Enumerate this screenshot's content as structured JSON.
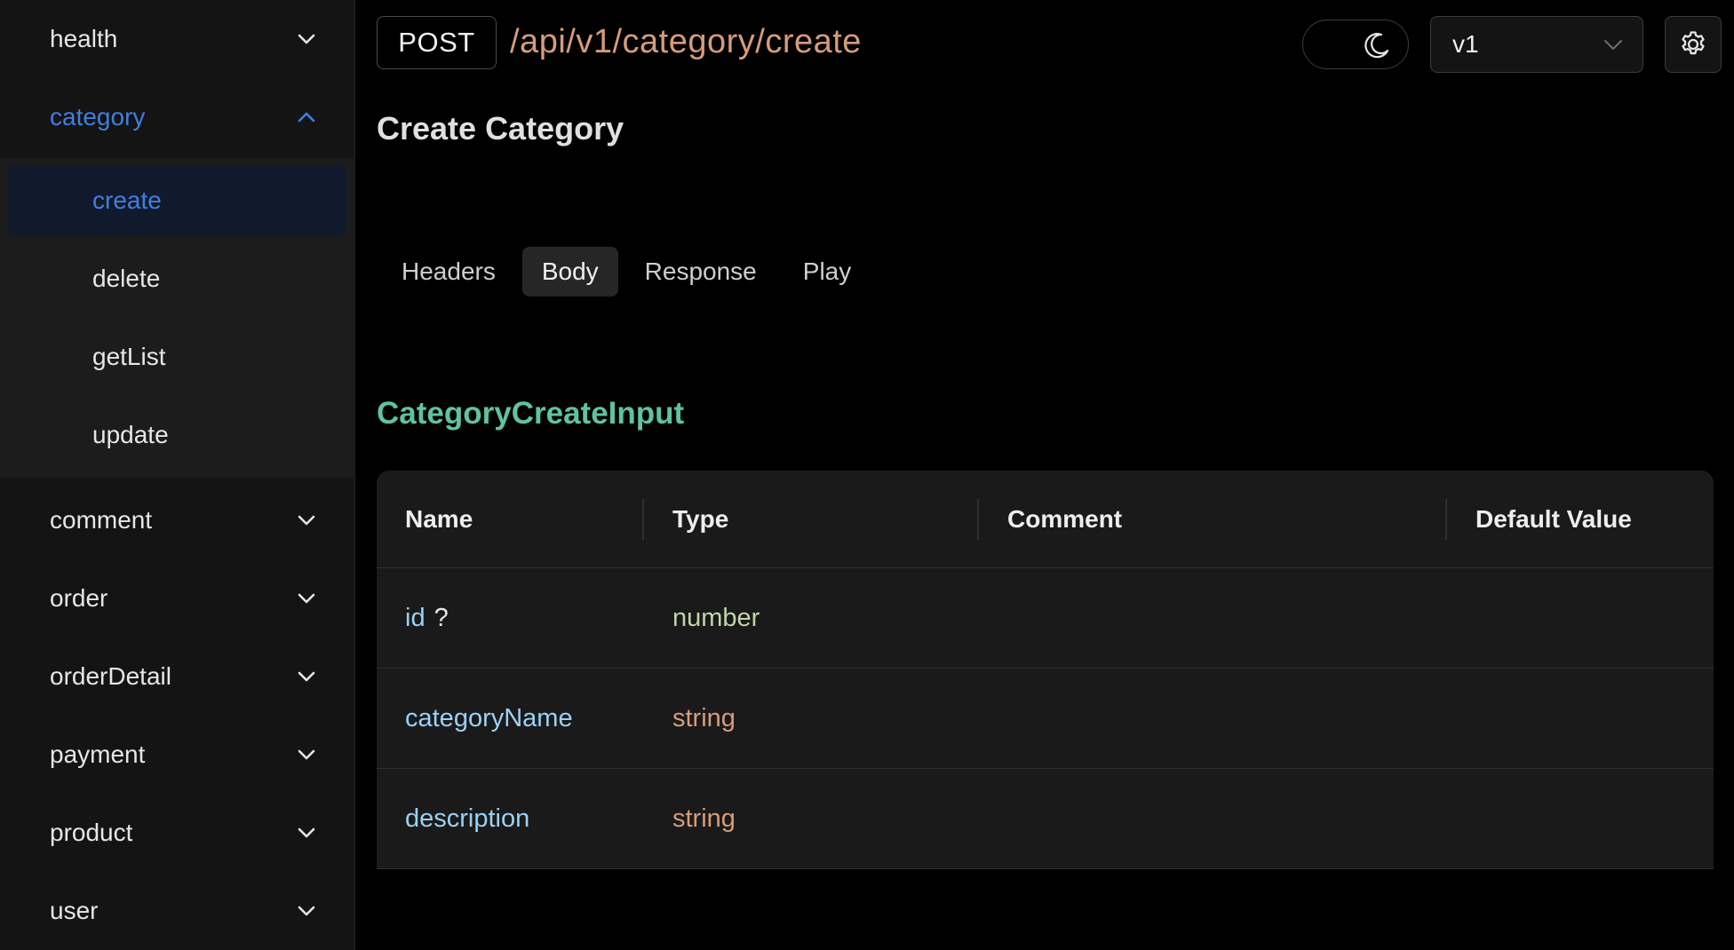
{
  "sidebar": {
    "groups": [
      {
        "label": "health"
      },
      {
        "label": "category"
      },
      {
        "label": "comment"
      },
      {
        "label": "order"
      },
      {
        "label": "orderDetail"
      },
      {
        "label": "payment"
      },
      {
        "label": "product"
      },
      {
        "label": "user"
      }
    ],
    "category_items": [
      {
        "label": "create"
      },
      {
        "label": "delete"
      },
      {
        "label": "getList"
      },
      {
        "label": "update"
      }
    ]
  },
  "header": {
    "method": "POST",
    "path": "/api/v1/category/create",
    "version": "v1",
    "theme_icon": "moon-icon",
    "settings_icon": "gear-icon"
  },
  "page": {
    "title": "Create Category"
  },
  "tabs": [
    {
      "label": "Headers"
    },
    {
      "label": "Body"
    },
    {
      "label": "Response"
    },
    {
      "label": "Play"
    }
  ],
  "schema": {
    "name": "CategoryCreateInput",
    "columns": [
      "Name",
      "Type",
      "Comment",
      "Default Value"
    ],
    "rows": [
      {
        "name": "id",
        "optional_mark": "?",
        "type": "number",
        "comment": "",
        "default": ""
      },
      {
        "name": "categoryName",
        "optional_mark": "",
        "type": "string",
        "comment": "",
        "default": ""
      },
      {
        "name": "description",
        "optional_mark": "",
        "type": "string",
        "comment": "",
        "default": ""
      }
    ]
  },
  "colors": {
    "accent": "#3f7fe0",
    "path": "#d69c7a",
    "schema_title": "#5fc2a3",
    "field_name": "#9cd0f5",
    "type_number": "#bfd6a8",
    "type_string": "#d69c7a"
  }
}
